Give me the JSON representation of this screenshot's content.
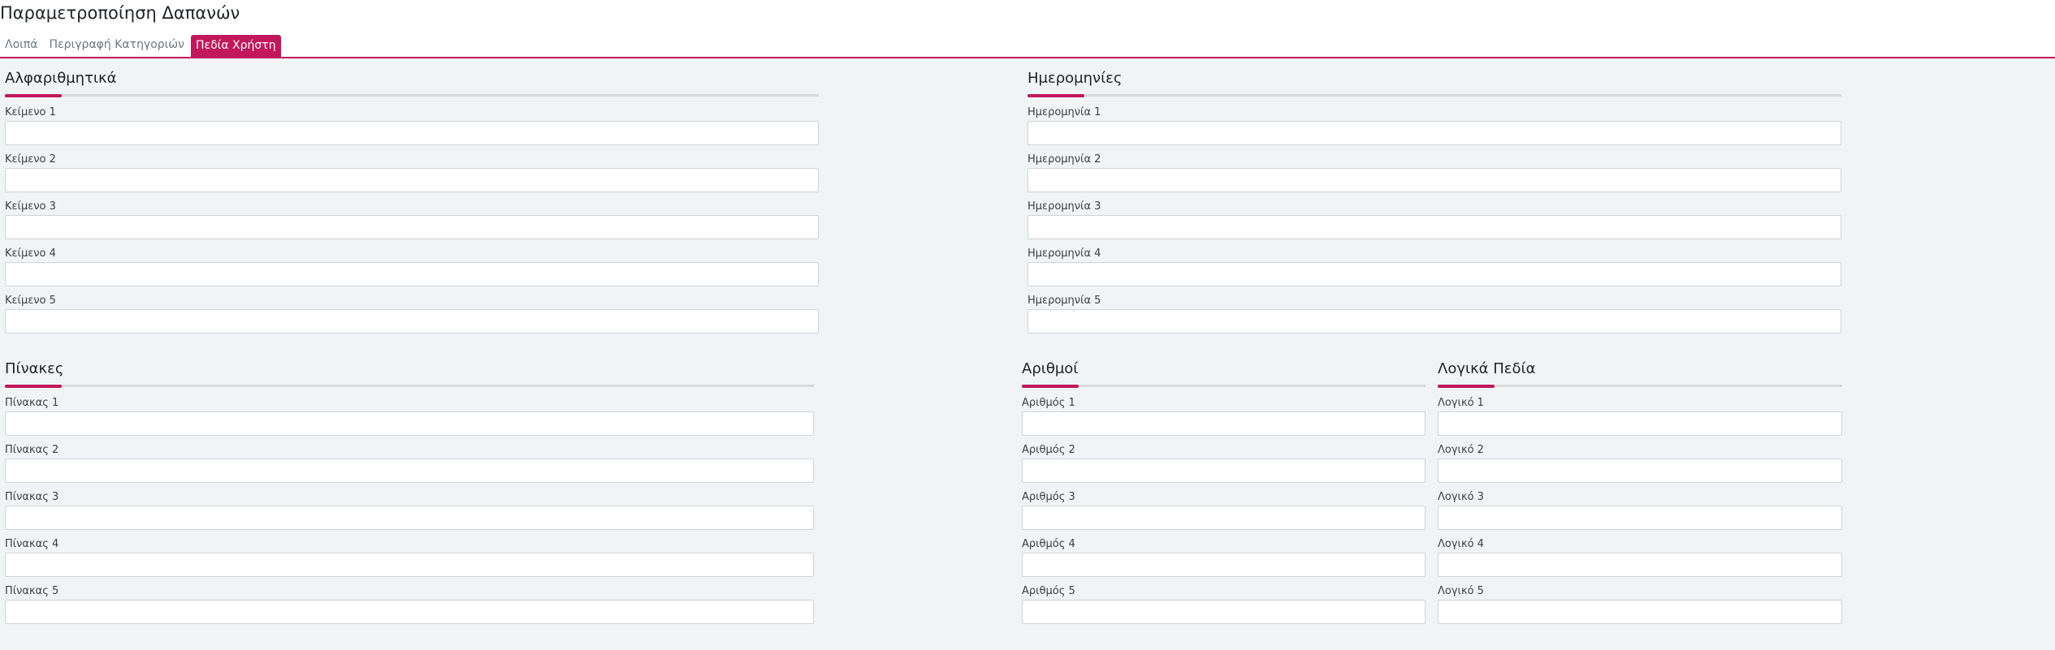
{
  "page_title": "Παραμετροποίηση Δαπανών",
  "tabs": [
    {
      "label": "Λοιπά"
    },
    {
      "label": "Περιγραφή Κατηγοριών"
    },
    {
      "label": "Πεδία Χρήστη"
    }
  ],
  "accent_color": "#c2185b",
  "sections": {
    "text": {
      "title": "Αλφαριθμητικά",
      "fields": [
        "Κείμενο 1",
        "Κείμενο 2",
        "Κείμενο 3",
        "Κείμενο 4",
        "Κείμενο 5"
      ]
    },
    "dates": {
      "title": "Ημερομηνίες",
      "fields": [
        "Ημερομηνία 1",
        "Ημερομηνία 2",
        "Ημερομηνία 3",
        "Ημερομηνία 4",
        "Ημερομηνία 5"
      ]
    },
    "tables": {
      "title": "Πίνακες",
      "fields": [
        "Πίνακας 1",
        "Πίνακας 2",
        "Πίνακας 3",
        "Πίνακας 4",
        "Πίνακας 5"
      ]
    },
    "numbers": {
      "title": "Αριθμοί",
      "fields": [
        "Αριθμός 1",
        "Αριθμός 2",
        "Αριθμός 3",
        "Αριθμός 4",
        "Αριθμός 5"
      ]
    },
    "logical": {
      "title": "Λογικά Πεδία",
      "fields": [
        "Λογικό 1",
        "Λογικό 2",
        "Λογικό 3",
        "Λογικό 4",
        "Λογικό 5"
      ]
    }
  }
}
